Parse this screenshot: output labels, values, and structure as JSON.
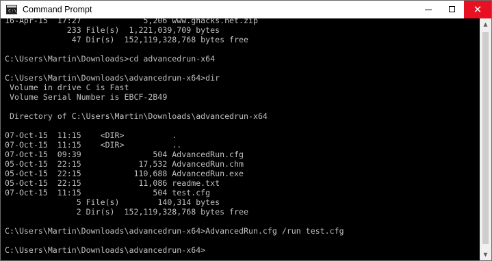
{
  "window": {
    "title": "Command Prompt",
    "icon": "cmd-app-icon",
    "icon_text": "C:\\"
  },
  "controls": {
    "minimize_icon": "minimize-icon",
    "maximize_icon": "maximize-icon",
    "close_icon": "close-icon",
    "close_glyph": "✕"
  },
  "colors": {
    "console_bg": "#000000",
    "console_text": "#c0c0c0",
    "close_hover": "#e81123"
  },
  "console": {
    "lines": [
      "16-Apr-15  17:27             5,206 www.ghacks.net.zip",
      "             233 File(s)  1,221,039,709 bytes",
      "              47 Dir(s)  152,119,328,768 bytes free",
      "",
      "C:\\Users\\Martin\\Downloads>cd advancedrun-x64",
      "",
      "C:\\Users\\Martin\\Downloads\\advancedrun-x64>dir",
      " Volume in drive C is Fast",
      " Volume Serial Number is EBCF-2B49",
      "",
      " Directory of C:\\Users\\Martin\\Downloads\\advancedrun-x64",
      "",
      "07-Oct-15  11:15    <DIR>          .",
      "07-Oct-15  11:15    <DIR>          ..",
      "07-Oct-15  09:39               504 AdvancedRun.cfg",
      "05-Oct-15  22:15            17,532 AdvancedRun.chm",
      "05-Oct-15  22:15           110,688 AdvancedRun.exe",
      "05-Oct-15  22:15            11,086 readme.txt",
      "07-Oct-15  11:15               504 test.cfg",
      "               5 File(s)        140,314 bytes",
      "               2 Dir(s)  152,119,328,768 bytes free",
      "",
      "C:\\Users\\Martin\\Downloads\\advancedrun-x64>AdvancedRun.cfg /run test.cfg",
      "",
      "C:\\Users\\Martin\\Downloads\\advancedrun-x64>"
    ]
  },
  "scrollbar": {
    "up_arrow": "▲",
    "down_arrow": "▼",
    "up_icon": "scroll-up-arrow-icon",
    "down_icon": "scroll-down-arrow-icon"
  }
}
